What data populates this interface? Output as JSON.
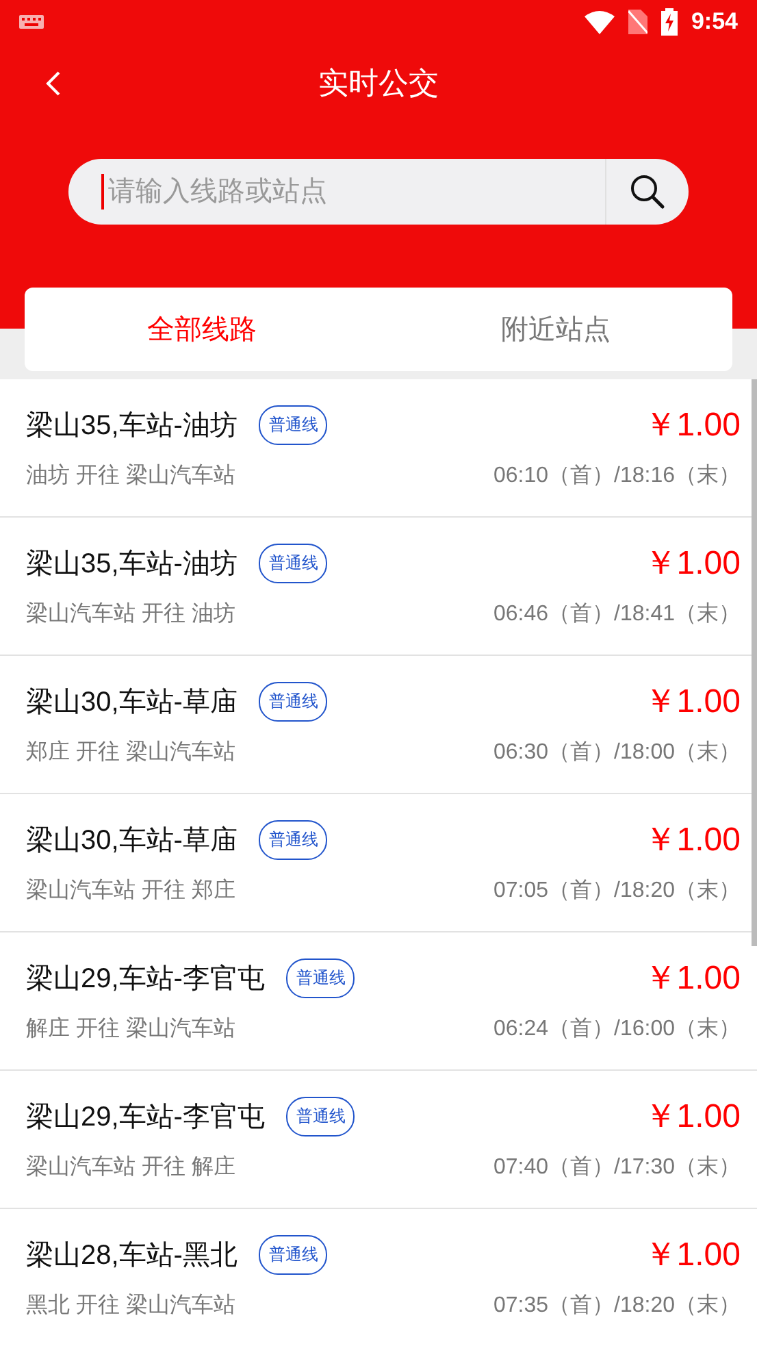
{
  "status_bar": {
    "time": "9:54"
  },
  "header": {
    "title": "实时公交"
  },
  "search": {
    "placeholder": "请输入线路或站点"
  },
  "tabs": [
    {
      "label": "全部线路",
      "selected": true
    },
    {
      "label": "附近站点",
      "selected": false
    }
  ],
  "routes": [
    {
      "name": "梁山35,车站-油坊",
      "type": "普通线",
      "price": "￥1.00",
      "direction": "油坊 开往 梁山汽车站",
      "times": "06:10（首）/18:16（末）"
    },
    {
      "name": "梁山35,车站-油坊",
      "type": "普通线",
      "price": "￥1.00",
      "direction": "梁山汽车站 开往 油坊",
      "times": "06:46（首）/18:41（末）"
    },
    {
      "name": "梁山30,车站-草庙",
      "type": "普通线",
      "price": "￥1.00",
      "direction": "郑庄 开往 梁山汽车站",
      "times": "06:30（首）/18:00（末）"
    },
    {
      "name": "梁山30,车站-草庙",
      "type": "普通线",
      "price": "￥1.00",
      "direction": "梁山汽车站 开往 郑庄",
      "times": "07:05（首）/18:20（末）"
    },
    {
      "name": "梁山29,车站-李官屯",
      "type": "普通线",
      "price": "￥1.00",
      "direction": "解庄 开往 梁山汽车站",
      "times": "06:24（首）/16:00（末）"
    },
    {
      "name": "梁山29,车站-李官屯",
      "type": "普通线",
      "price": "￥1.00",
      "direction": "梁山汽车站 开往 解庄",
      "times": "07:40（首）/17:30（末）"
    },
    {
      "name": "梁山28,车站-黑北",
      "type": "普通线",
      "price": "￥1.00",
      "direction": "黑北 开往 梁山汽车站",
      "times": "07:35（首）/18:20（末）"
    }
  ]
}
